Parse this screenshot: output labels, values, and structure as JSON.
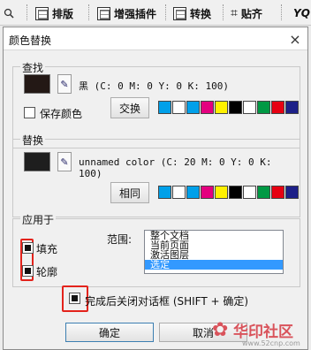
{
  "toolbar": {
    "typeset_label": "排版",
    "plugins_label": "增强插件",
    "convert_label": "转换",
    "paste_align_label": "贴齐",
    "cut_off_label": "YQ"
  },
  "dialog": {
    "title": "颜色替换",
    "close_glyph": "×",
    "find": {
      "group_title": "查找",
      "swatch_color": "#231815",
      "color_desc": "黑 (C: 0 M: 0 Y: 0 K: 100)",
      "keep_color_label": "保存颜色",
      "action_label": "交换"
    },
    "replace": {
      "group_title": "替换",
      "swatch_color": "#1e1e1e",
      "color_desc": "unnamed color (C: 20 M: 0 Y: 0 K: 100)",
      "action_label": "相同"
    },
    "palette": [
      "#00a0e9",
      "#ffffff",
      "#00a0e9",
      "#e4007f",
      "#fff100",
      "#000000",
      "#ffffff",
      "#009944",
      "#e60012",
      "#1d2088"
    ],
    "apply": {
      "group_title": "应用于",
      "fill_label": "填充",
      "outline_label": "轮廓",
      "range_label": "范围:",
      "range_options": [
        "整个文档",
        "当前页面",
        "激活图层",
        "选定"
      ],
      "selected_range": "选定"
    },
    "close_after_label": "完成后关闭对话框 (SHIFT + 确定)",
    "ok_label": "确定",
    "cancel_label": "取消"
  },
  "watermark": {
    "brand": "华印社区",
    "url": "www.52cnp.com"
  },
  "colors": {
    "highlight_red": "#e3231c",
    "selection_blue": "#3399ff"
  }
}
